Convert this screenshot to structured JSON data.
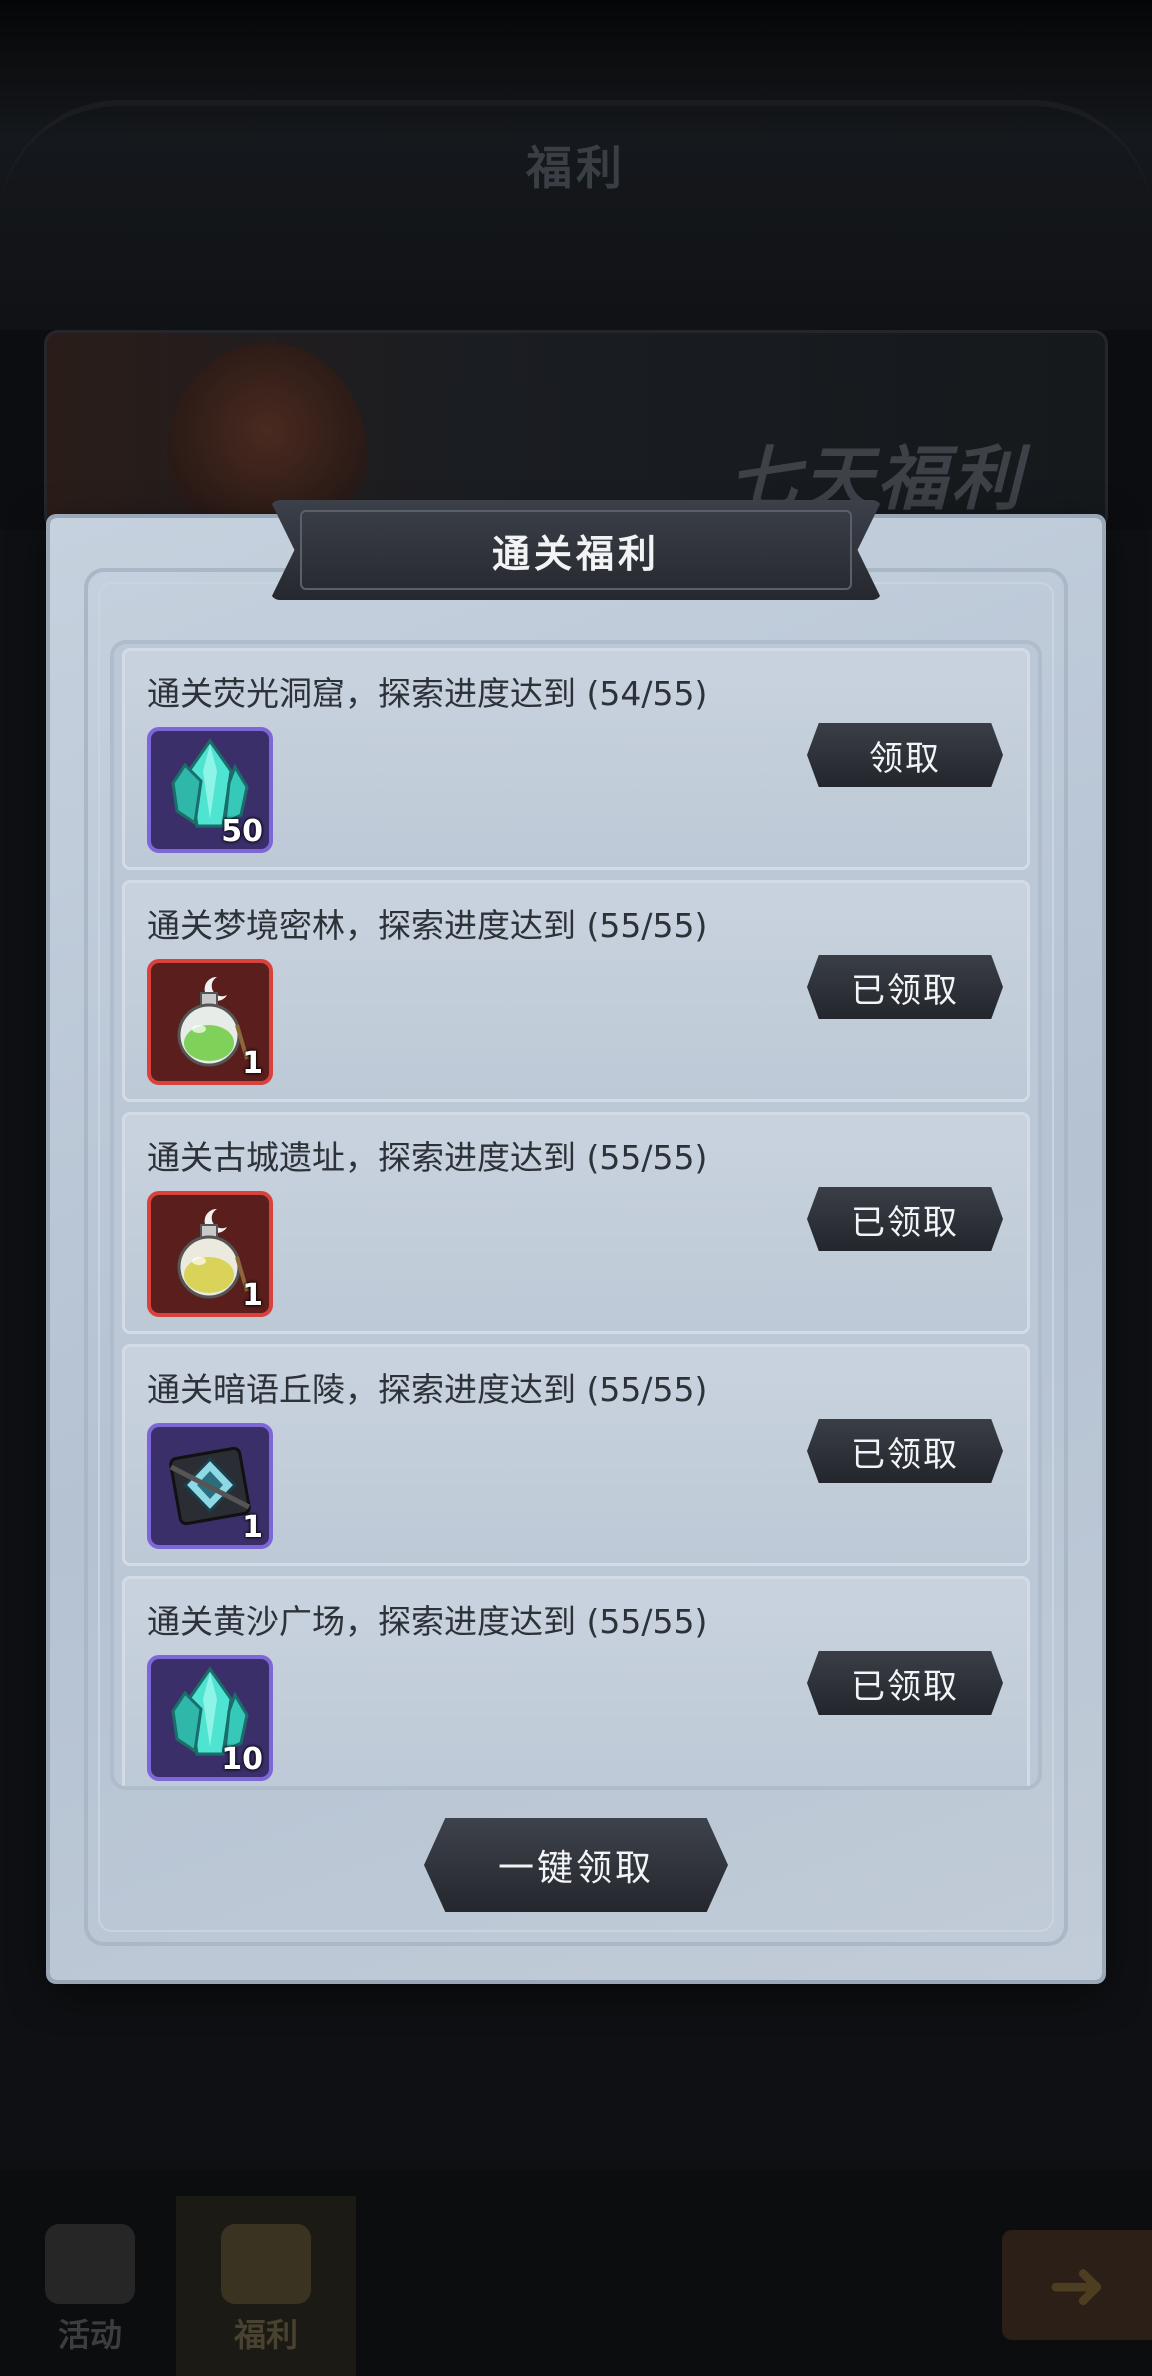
{
  "background": {
    "header_title": "福利",
    "banner_title": "七天福利",
    "tabs": [
      {
        "label": "活动"
      },
      {
        "label": "福利"
      }
    ]
  },
  "popup": {
    "title": "通关福利",
    "one_key_claim_label": "一键领取",
    "tasks": [
      {
        "title": "通关荧光洞窟，探索进度达到 (54/55)",
        "reward_icon": "crystal-icon",
        "rarity": "purple",
        "quantity": "50",
        "button_label": "领取",
        "claimed": false
      },
      {
        "title": "通关梦境密林，探索进度达到 (55/55)",
        "reward_icon": "green-potion-icon",
        "rarity": "red",
        "quantity": "1",
        "button_label": "已领取",
        "claimed": true
      },
      {
        "title": "通关古城遗址，探索进度达到 (55/55)",
        "reward_icon": "yellow-potion-icon",
        "rarity": "red",
        "quantity": "1",
        "button_label": "已领取",
        "claimed": true
      },
      {
        "title": "通关暗语丘陵，探索进度达到 (55/55)",
        "reward_icon": "rune-crate-icon",
        "rarity": "purple",
        "quantity": "1",
        "button_label": "已领取",
        "claimed": true
      },
      {
        "title": "通关黄沙广场，探索进度达到 (55/55)",
        "reward_icon": "crystal-icon",
        "rarity": "purple",
        "quantity": "10",
        "button_label": "已领取",
        "claimed": true
      }
    ]
  }
}
